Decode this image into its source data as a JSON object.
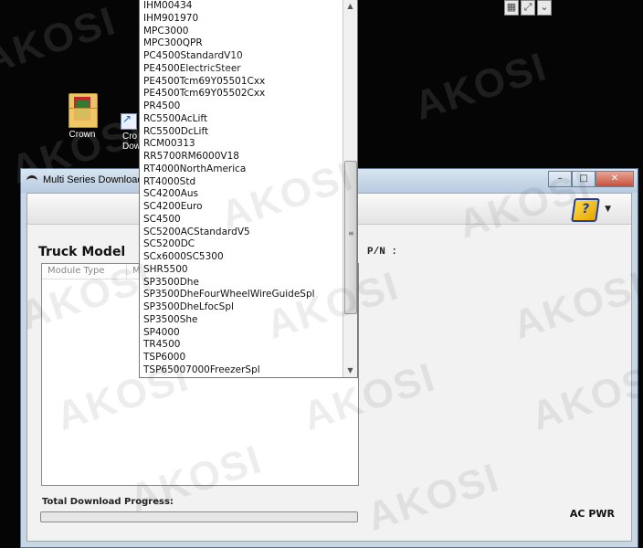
{
  "desktop": {
    "icons": [
      {
        "label": "Crown"
      },
      {
        "label": "Cro Dow"
      }
    ]
  },
  "window": {
    "title": "Multi Series Download",
    "controls": {
      "minimize": "–",
      "maximize": "□",
      "close": "✕"
    }
  },
  "main": {
    "truck_model_title": "Truck Model",
    "pn_label": "P/N :",
    "list_columns": [
      "Module Type",
      "Mod"
    ],
    "progress_label": "Total Download Progress:",
    "progress_value": 0,
    "ac_pwr": "AC PWR"
  },
  "dropdown": {
    "items": [
      "IHM00434",
      "IHM901970",
      "MPC3000",
      "MPC300QPR",
      "PC4500StandardV10",
      "PE4500ElectricSteer",
      "PE4500Tcm69Y05501Cxx",
      "PE4500Tcm69Y05502Cxx",
      "PR4500",
      "RC5500AcLift",
      "RC5500DcLift",
      "RCM00313",
      "RR5700RM6000V18",
      "RT4000NorthAmerica",
      "RT4000Std",
      "SC4200Aus",
      "SC4200Euro",
      "SC4500",
      "SC5200ACStandardV5",
      "SC5200DC",
      "SCx6000SC5300",
      "SHR5500",
      "SP3500Dhe",
      "SP3500DheFourWheelWireGuideSpl",
      "SP3500DheLfocSpl",
      "SP3500She",
      "SP4000",
      "TR4500",
      "TSP6000",
      "TSP65007000FreezerSpl"
    ]
  },
  "watermark": "AKOSI",
  "colors": {
    "progress": "#3ea34a",
    "close_button": "#c5523c"
  },
  "icons": {
    "help": "help-book-icon",
    "dropdown": "chevron-down-icon"
  }
}
